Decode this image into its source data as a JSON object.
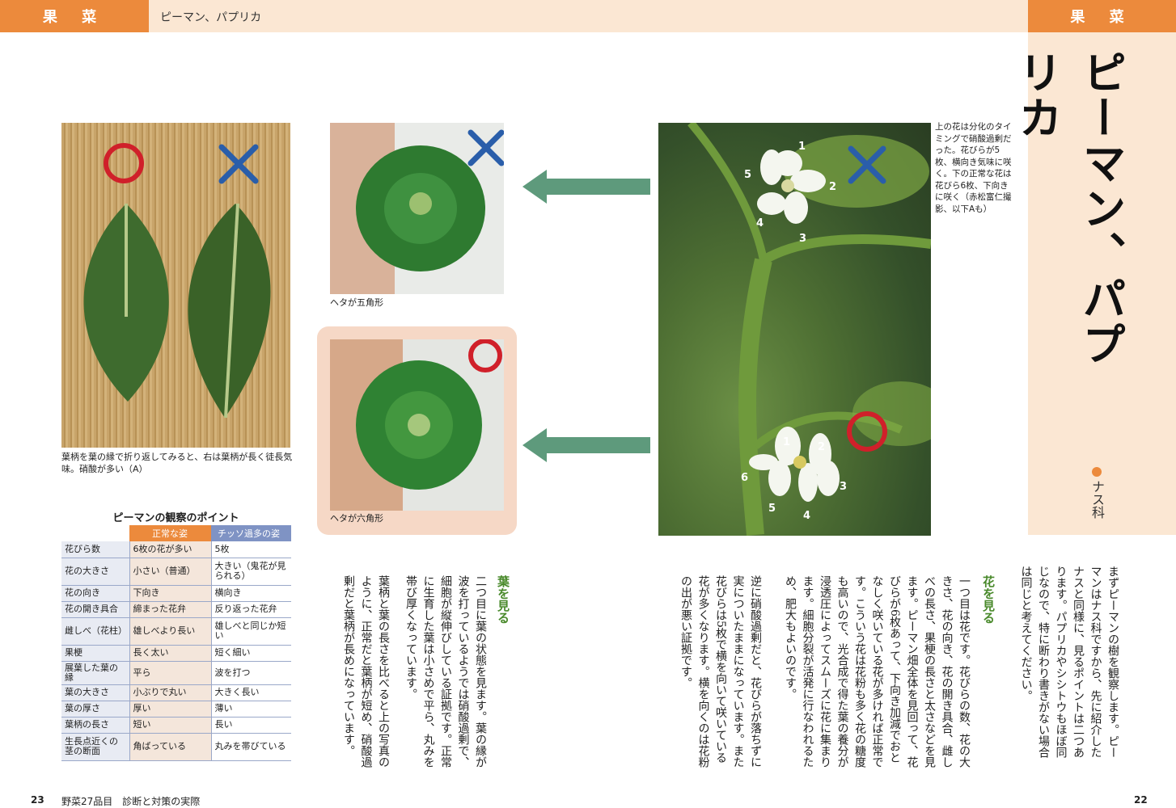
{
  "header": {
    "left_tab": "果 菜",
    "title": "ピーマン、パプリカ",
    "right_tab": "果 菜"
  },
  "sidebar": {
    "big_title": "ピーマン、パプリカ",
    "family": "ナス科"
  },
  "captions": {
    "leaf": "葉柄を葉の縁で折り返してみると、右は葉柄が長く徒長気味。硝酸が多い（A）",
    "pepper_top": "ヘタが五角形",
    "pepper_bottom": "ヘタが六角形",
    "flower": "上の花は分化のタイミングで硝酸過剰だった。花びらが5枚、横向き気味に咲く。下の正常な花は花びら6枚、下向きに咲く（赤松富仁撮影、以下Aも）"
  },
  "petal_numbers": {
    "upper": [
      "1",
      "2",
      "3",
      "4",
      "5"
    ],
    "lower": [
      "1",
      "2",
      "3",
      "4",
      "5",
      "6"
    ]
  },
  "table": {
    "title": "ピーマンの観察のポイント",
    "headers": [
      "",
      "正常な姿",
      "チッソ過多の姿"
    ],
    "rows": [
      [
        "花びら数",
        "6枚の花が多い",
        "5枚"
      ],
      [
        "花の大きさ",
        "小さい（普通）",
        "大きい（鬼花が見られる）"
      ],
      [
        "花の向き",
        "下向き",
        "横向き"
      ],
      [
        "花の開き具合",
        "締まった花弁",
        "反り返った花弁"
      ],
      [
        "雌しべ（花柱）",
        "雄しべより長い",
        "雄しべと同じか短い"
      ],
      [
        "果梗",
        "長く太い",
        "短く細い"
      ],
      [
        "展葉した葉の縁",
        "平ら",
        "波を打つ"
      ],
      [
        "葉の大きさ",
        "小ぶりで丸い",
        "大きく長い"
      ],
      [
        "葉の厚さ",
        "厚い",
        "薄い"
      ],
      [
        "葉柄の長さ",
        "短い",
        "長い"
      ],
      [
        "生長点近くの茎の断面",
        "角ばっている",
        "丸みを帯びている"
      ]
    ]
  },
  "body": {
    "intro": "まずピーマンの樹を観察します。ピーマンはナス科ですから、先に紹介したナスと同様に、見るポイントは二つあります。パプリカやシシトウもほぼ同じなので、特に断わり書きがない場合は同じと考えてください。",
    "flower_heading": "花を見る",
    "flower_text1": "一つ目は花です。花びらの数、花の大きさ、花の向き、花の開き具合、雌しべの長さ、果梗の長さと太さなどを見ます。ピーマン畑全体を見回って、花びらが6枚あって、下向き加減でおとなしく咲いている花が多ければ正常です。こういう花は花粉も多く花の糖度も高いので、光合成で得た葉の養分が浸透圧によってスムーズに花に集まります。細胞分裂が活発に行なわれるため、肥大もよいのです。",
    "flower_text2": "逆に硝酸過剰だと、花びらが落ちずに実についたままになっています。また花びらは5枚で横を向いて咲いている花が多くなります。横を向くのは花粉の出が悪い証拠です。",
    "leaf_heading": "葉を見る",
    "leaf_text1": "二つ目に葉の状態を見ます。葉の縁が波を打っているようでは硝酸過剰で、細胞が縦伸びしている証拠です。正常に生育した葉は小さめで平ら、丸みを帯び厚くなっています。",
    "leaf_text2": "葉柄と葉の長さを比べると上の写真のように、正常だと葉柄が短め、硝酸過剰だと葉柄が長めになっています。"
  },
  "footer": {
    "left_page": "23",
    "left_text": "野菜27品目　診断と対策の実際",
    "right_page": "22"
  },
  "colors": {
    "accent_orange": "#ec8a3c",
    "header_bg": "#fbe7d3",
    "good_red": "#d0202a",
    "bad_blue": "#2a5eaa",
    "arrow_green": "#5e9a7c",
    "heading_green": "#4a8a2c"
  }
}
